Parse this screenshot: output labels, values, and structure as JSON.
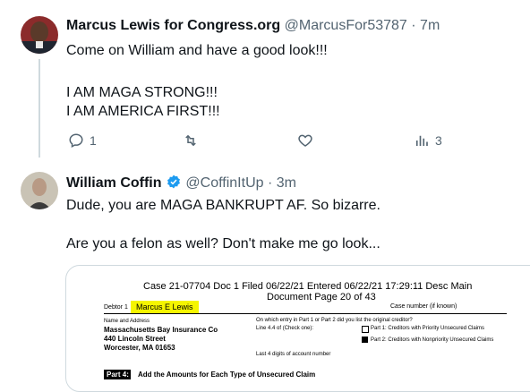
{
  "tweet1": {
    "name": "Marcus Lewis for Congress.org",
    "handle": "@MarcusFor53787",
    "time": "· 7m",
    "lines": [
      "Come on William and have a good look!!!",
      "I AM MAGA STRONG!!!",
      "I AM AMERICA FIRST!!!"
    ],
    "replies": "1",
    "views": "3"
  },
  "tweet2": {
    "name": "William Coffin",
    "handle": "@CoffinItUp",
    "time": "· 3m",
    "lines": [
      "Dude, you are MAGA BANKRUPT AF. So bizarre.",
      "Are you a felon as well? Don't make me go look..."
    ]
  },
  "document": {
    "case_header": "Case 21-07704    Doc 1    Filed 06/22/21    Entered 06/22/21 17:29:11    Desc Main",
    "doc_line": "Document       Page 20 of 43",
    "debtor_label": "Debtor 1",
    "debtor_name": "Marcus E Lewis",
    "case_number": "Case number (if known)",
    "name_address_label": "Name and Address",
    "creditor_lines": [
      "Massachusetts Bay Insurance Co",
      "440 Lincoln Street",
      "Worcester, MA 01653"
    ],
    "which_entry": "On which entry in Part 1 or Part 2 did you list the original creditor?",
    "line_ref": "Line 4.4 of (Check one):",
    "part1_option": "Part 1: Creditors with Priority Unsecured Claims",
    "part2_option": "Part 2: Creditors with Nonpriority Unsecured Claims",
    "last4": "Last 4 digits of account number",
    "part4_label": "Part 4:",
    "part4_title": "Add the Amounts for Each Type of Unsecured Claim"
  },
  "colors": {
    "text": "#0f1419",
    "secondary": "#536471",
    "verified": "#1d9bf0",
    "thread_line": "#cfd9de",
    "highlight": "#f5f500"
  }
}
